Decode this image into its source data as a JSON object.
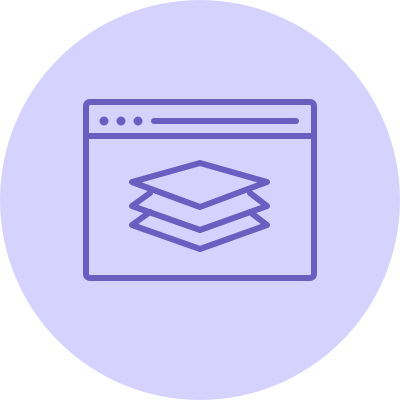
{
  "icon": {
    "name": "browser-window-layers-icon",
    "depicts": [
      "browser-window",
      "stacked-layers"
    ]
  },
  "colors": {
    "circle_background": "#d6d2fe",
    "line_stroke": "#6a5ec0"
  }
}
